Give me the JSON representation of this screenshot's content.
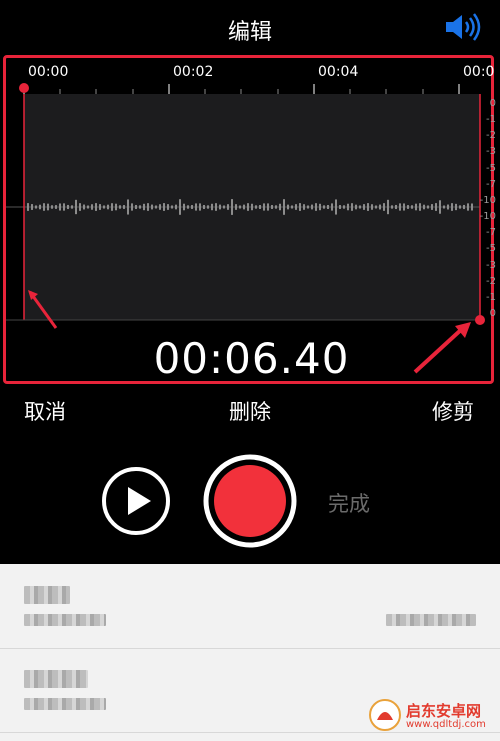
{
  "header": {
    "title": "编辑"
  },
  "timeline": {
    "ticks": [
      "00:00",
      "00:02",
      "00:04",
      "00:0"
    ]
  },
  "db_scale": [
    "0",
    "-1",
    "-2",
    "-3",
    "-5",
    "-7",
    "-10",
    "-10",
    "-7",
    "-5",
    "-3",
    "-2",
    "-1",
    "0"
  ],
  "display": {
    "time": "00:06.40"
  },
  "actions": {
    "cancel": "取消",
    "delete": "删除",
    "trim": "修剪"
  },
  "transport": {
    "done": "完成"
  },
  "colors": {
    "accent_red": "#e8243a",
    "record_red": "#f2313b",
    "speaker_blue": "#1a73e8",
    "waveform_bg": "#1c1c1e"
  },
  "icons": {
    "speaker": "speaker-volume-icon",
    "play": "play-icon",
    "record": "record-icon"
  },
  "watermark": {
    "name": "启东安卓网",
    "url": "www.qdltdj.com"
  }
}
